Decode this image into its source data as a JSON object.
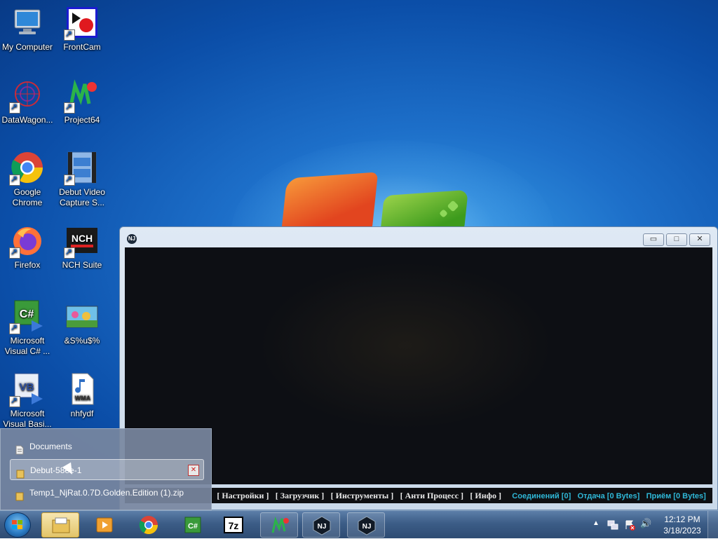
{
  "desktop": {
    "icons": [
      {
        "label": "My Computer",
        "icon": "computer-icon"
      },
      {
        "label": "FrontCam",
        "icon": "frontcam-icon"
      },
      {
        "label": "DataWagon...",
        "icon": "datawagon-icon"
      },
      {
        "label": "Project64",
        "icon": "project64-icon"
      },
      {
        "label": "Google Chrome",
        "icon": "chrome-icon"
      },
      {
        "label": "Debut Video Capture S...",
        "icon": "debut-icon"
      },
      {
        "label": "Firefox",
        "icon": "firefox-icon"
      },
      {
        "label": "NCH Suite",
        "icon": "nch-icon"
      },
      {
        "label": "Microsoft Visual C# ...",
        "icon": "visual-csharp-icon"
      },
      {
        "label": "&S%u$%",
        "icon": "image-file-icon"
      },
      {
        "label": "Microsoft Visual Basi...",
        "icon": "visual-basic-icon"
      },
      {
        "label": "nhfydf",
        "icon": "wma-file-icon"
      }
    ]
  },
  "njrat_window": {
    "icon_text": "NJ",
    "controls": {
      "minimize": "▭",
      "maximize": "□",
      "close": "✕"
    },
    "menu": [
      "[ Настройки ]",
      "[ Загрузчик ]",
      "[ Инструменты ]",
      "[ Анти Процесс ]",
      "[ Инфо ]"
    ],
    "status": [
      "Соединений [0]",
      "Отдача [0 Bytes]",
      "Приём [0 Bytes]"
    ]
  },
  "jumplist": {
    "items": [
      {
        "label": "Documents",
        "icon": "documents-icon"
      },
      {
        "label": "Debut-58ee-1",
        "icon": "folder-icon",
        "hover": true
      },
      {
        "label": "Temp1_NjRat.0.7D.Golden.Edition (1).zip",
        "icon": "folder-icon"
      }
    ],
    "close_glyph": "✕"
  },
  "taskbar": {
    "buttons": [
      "windows-explorer-icon",
      "debut-icon",
      "chrome-icon",
      "visual-csharp-icon",
      "7zip-icon",
      "project64-icon",
      "njrat-icon",
      "njrat-icon"
    ],
    "labels": {
      "sevenzip": "7z",
      "csharp": "C#",
      "nj": "NJ"
    },
    "tray": {
      "chevron": "▲",
      "speaker": "🔊"
    },
    "time": "12:12 PM",
    "date": "3/18/2023"
  },
  "colors": {
    "status_accent": "#2fb8d8",
    "taskbar": "#3c5d87",
    "desktop": "#1d6fc9"
  }
}
